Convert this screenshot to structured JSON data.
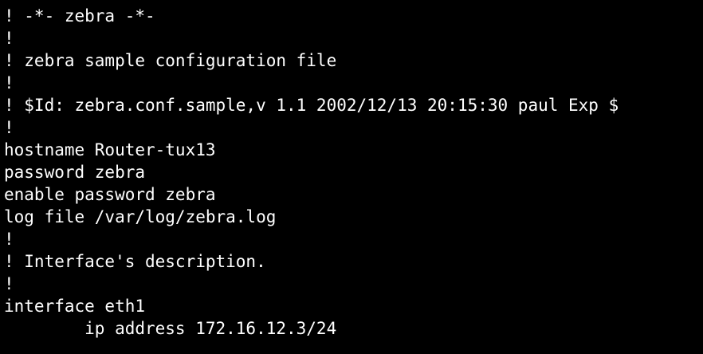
{
  "terminal": {
    "background": "#000000",
    "foreground": "#ffffff",
    "lines": [
      "! -*- zebra -*-",
      "!",
      "! zebra sample configuration file",
      "!",
      "! $Id: zebra.conf.sample,v 1.1 2002/12/13 20:15:30 paul Exp $",
      "!",
      "hostname Router-tux13",
      "password zebra",
      "enable password zebra",
      "log file /var/log/zebra.log",
      "!",
      "! Interface's description.",
      "!",
      "interface eth1",
      "        ip address 172.16.12.3/24"
    ]
  }
}
